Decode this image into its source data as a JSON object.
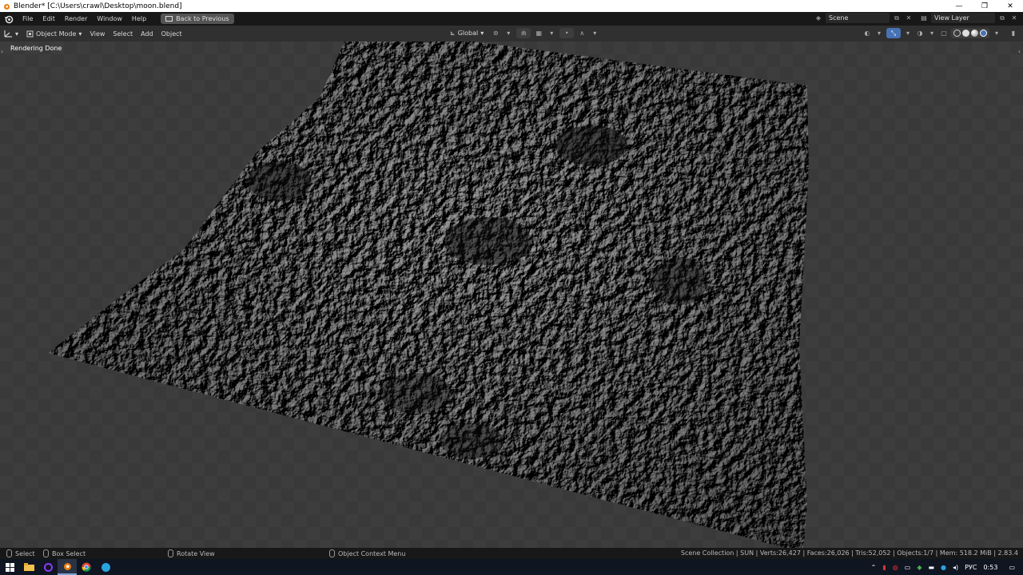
{
  "window": {
    "title": "Blender* [C:\\Users\\crawl\\Desktop\\moon.blend]",
    "controls": {
      "minimize": "—",
      "restore": "❐",
      "close": "✕"
    }
  },
  "menu": {
    "items": [
      "File",
      "Edit",
      "Render",
      "Window",
      "Help"
    ],
    "back_button": "Back to Previous"
  },
  "scene": {
    "label": "Scene",
    "view_layer": "View Layer"
  },
  "viewport_header": {
    "mode": "Object Mode",
    "menus": [
      "View",
      "Select",
      "Add",
      "Object"
    ],
    "transform_orientation": "Global"
  },
  "viewport": {
    "status_text": "Rendering Done"
  },
  "statusbar": {
    "select": "Select",
    "box_select": "Box Select",
    "rotate_view": "Rotate View",
    "context_menu": "Object Context Menu",
    "stats": "Scene Collection | SUN | Verts:26,427 | Faces:26,026 | Tris:52,052 | Objects:1/7 | Mem: 518.2 MiB | 2.83.4"
  },
  "taskbar": {
    "tray_lang": "РУС",
    "clock": "0:53"
  },
  "colors": {
    "accent_blue": "#4772b3",
    "header_bg": "#303030",
    "topbar_bg": "#181818",
    "blender_orange": "#e87d0d"
  }
}
